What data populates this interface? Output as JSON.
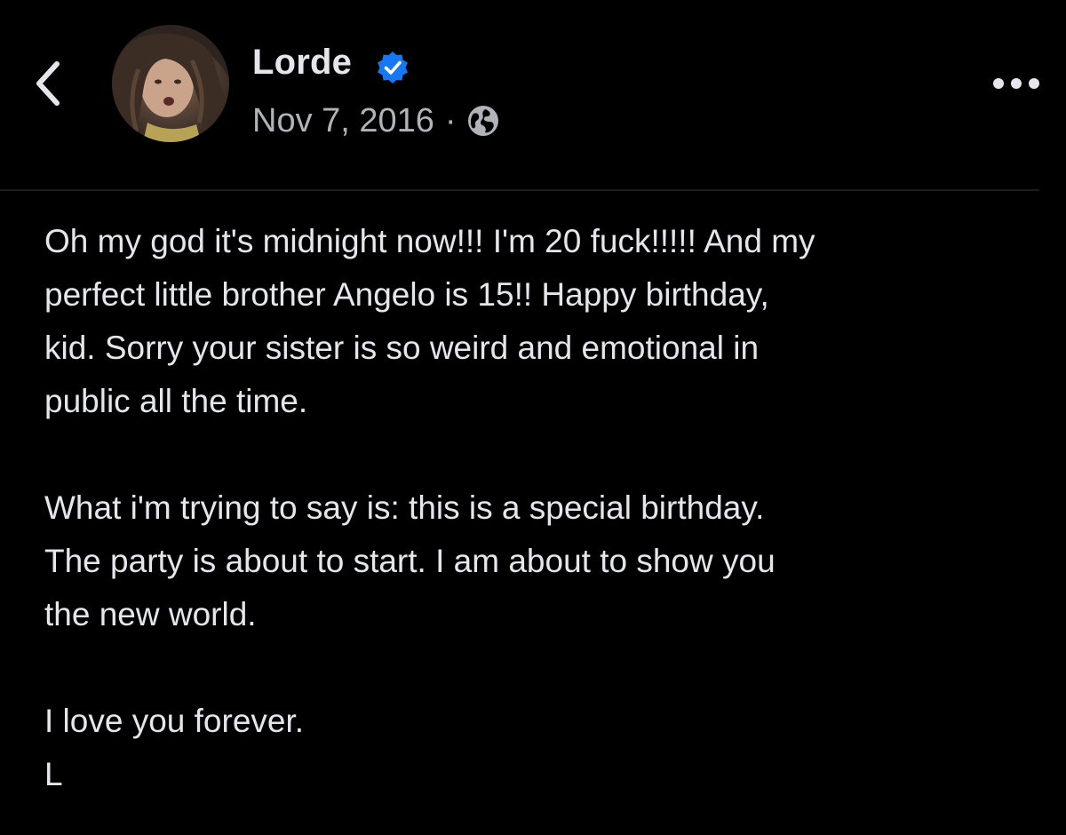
{
  "colors": {
    "background": "#000000",
    "primary_text": "#e4e6eb",
    "secondary_text": "#b0b3b8",
    "verified_badge": "#1877f2"
  },
  "header": {
    "back_icon": "chevron-left-icon",
    "author": {
      "name": "Lorde",
      "verified": true,
      "verified_icon": "verified-badge-icon",
      "avatar_icon": "profile-photo"
    },
    "date": "Nov 7, 2016",
    "separator": "·",
    "audience_icon": "globe-icon",
    "more_icon": "more-options-icon"
  },
  "post": {
    "paragraphs": [
      {
        "lines": [
          "Oh my god it's midnight now!!! I'm 20 fuck!!!!! And my",
          "perfect little brother Angelo is 15!! Happy birthday,",
          "kid. Sorry your sister is so weird and emotional in",
          "public all the time."
        ]
      },
      {
        "lines": [
          "What i'm trying to say is: this is a special birthday.",
          "The party is about to start. I am about to show you",
          "the new world."
        ]
      },
      {
        "lines": [
          "I love you forever.",
          "L"
        ]
      }
    ]
  }
}
